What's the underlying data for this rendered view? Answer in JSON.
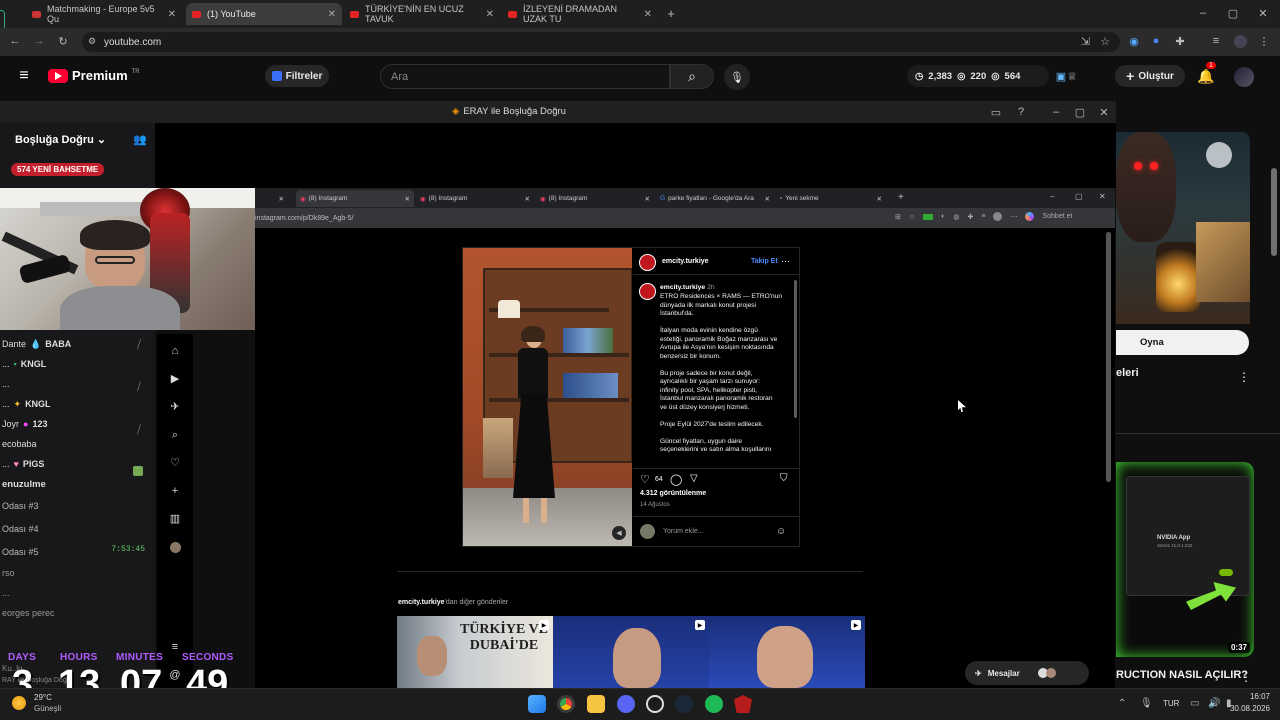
{
  "browser": {
    "tabs": [
      {
        "title": "Matchmaking - Europe 5v5 Qu"
      },
      {
        "title": "(1) YouTube"
      },
      {
        "title": "TÜRKİYE'NİN EN UCUZ TAVUK"
      },
      {
        "title": "İZLEYENİ DRAMADAN UZAK TU"
      }
    ],
    "url": "youtube.com"
  },
  "youtube": {
    "brand": "Premium",
    "region": "TR",
    "filters_label": "Filtreler",
    "search_placeholder": "Ara",
    "stats": {
      "a": "2,383",
      "b": "220",
      "c": "564"
    },
    "create_label": "Oluştur",
    "notif_count": "1",
    "right_col": {
      "play_label": "Oyna",
      "title1": "eleri",
      "title2": "RUCTION NASIL AÇILIR?",
      "duration": "0:37",
      "thumb_text": {
        "app": "NVIDIA App",
        "ver": "Sürüm 11.0.1.232"
      }
    }
  },
  "popout": {
    "title": "ERAY ile Boşluğa Doğru"
  },
  "chat": {
    "header": "Boşluğa Doğru",
    "promo": "574 YENİ BAHSETME",
    "lines": [
      {
        "user": "Dante",
        "badge": "BABA"
      },
      {
        "user": "...",
        "badge": "KNGL"
      },
      {
        "user": "...",
        "badge": ""
      },
      {
        "user": "...",
        "badge": "KNGL"
      },
      {
        "user": "Joyr",
        "badge": "123"
      },
      {
        "user": "ecobaba",
        "badge": ""
      },
      {
        "user": "...",
        "badge": "PIGS"
      }
    ],
    "section": "enuzulme",
    "rooms": [
      "Odası #3",
      "Odası #4",
      "Odası #5"
    ],
    "room_time": "7:53:45",
    "misc": [
      "rso",
      "...",
      "eorges perec"
    ],
    "footer": [
      "Ku..lu",
      "RAY ile Boşluğa Doğ"
    ]
  },
  "countdown": {
    "labels": [
      "DAYS",
      "HOURS",
      "MINUTES",
      "SECONDS"
    ],
    "values": [
      "3",
      "13",
      "07",
      "49"
    ]
  },
  "weather": {
    "temp": "29°C",
    "desc": "Güneşli"
  },
  "inner_browser": {
    "tabs": [
      "(8) Instagram",
      "(8) Instagram",
      "(8) Instagram",
      "(8) Instagram",
      "parke fiyatları - Google'da Ara",
      "Yeni sekme"
    ],
    "url": "instagram.com/p/Dk89e_Agb-5/",
    "chat_button": "Sohbet et"
  },
  "post": {
    "account": "emcity.turkiye",
    "follow": "Takip Et",
    "time": "2h",
    "caption_lines": [
      "ETRO Residences × RAMS — ETRO'nun",
      "dünyada ilk markalı konut projesi",
      "İstanbul'da.",
      "",
      "İtalyan moda evinin kendine özgü",
      "estetiği, panoramik Boğaz manzarası ve",
      "Avrupa ile Asya'nın kesişim noktasında",
      "benzersiz bir konum.",
      "",
      "Bu proje sadece bir konut değil,",
      "ayrıcalıklı bir yaşam tarzı sunuyor:",
      "infinity pool, SPA, helikopter pisti,",
      "İstanbul manzaralı panoramik restoran",
      "ve üst düzey konsiyerj hizmeti.",
      "",
      "Proje Eylül 2027'de teslim edilecek.",
      "",
      "Güncel fiyatları, uygun daire",
      "seçeneklerini ve satın alma koşullarını"
    ],
    "likes": "64",
    "views": "4.312 görüntülenme",
    "date": "14 Ağustos",
    "comment_placeholder": "Yorum ekle...",
    "more_from_account": "emcity.turkiye",
    "more_from_suffix": "'dan diğer gönderiler",
    "thumb1_text": [
      "TÜRKİYE VE",
      "DUBAİ'DE"
    ],
    "messages": "Mesajlar"
  },
  "taskbar": {
    "lang": "TUR",
    "time": "16:07",
    "date": "30.08.2026"
  }
}
